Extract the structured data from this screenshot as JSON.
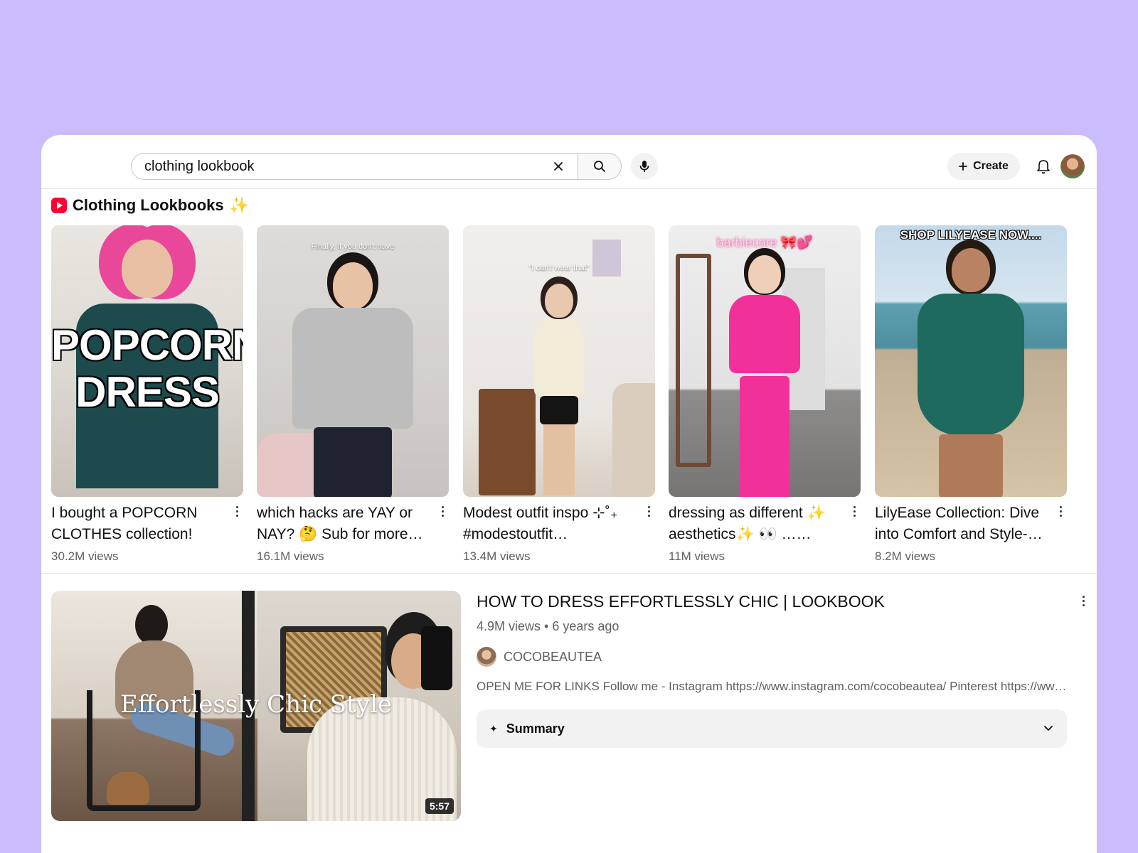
{
  "search": {
    "query": "clothing lookbook"
  },
  "header": {
    "create_label": "Create"
  },
  "shelf": {
    "title": "Clothing Lookbooks",
    "title_sparkle": "✨",
    "items": [
      {
        "title": "I bought a POPCORN CLOTHES collection!",
        "views": "30.2M views",
        "overlay": "POPCORN DRESS"
      },
      {
        "title": "which hacks are YAY or NAY? 🤔  Sub for more…",
        "views": "16.1M views",
        "overlay": "Finally, if you don't have"
      },
      {
        "title": "Modest outfit inspo ⊹˚₊ #modestoutfit…",
        "views": "13.4M views",
        "overlay": "\"I can't wear that\""
      },
      {
        "title": "dressing as different ✨ aesthetics✨ 👀 ……",
        "views": "11M views",
        "overlay": "barbiecore 🎀💕"
      },
      {
        "title": "LilyEase Collection: Dive into Comfort and Style-…",
        "views": "8.2M views",
        "overlay": "SHOP LILYEASE NOW...."
      }
    ]
  },
  "video": {
    "title": "HOW TO DRESS EFFORTLESSLY CHIC | LOOKBOOK",
    "stats": "4.9M views • 6 years ago",
    "channel": "COCOBEAUTEA",
    "description": "OPEN ME FOR LINKS Follow me - Instagram https://www.instagram.com/cocobeautea/ Pinterest https://www.pinterest.com/cocobeautea/",
    "overlay_text": "Effortlessly Chic Style",
    "duration": "5:57",
    "summary_label": "Summary"
  },
  "icons": {
    "clear": "close-icon",
    "search": "search-icon",
    "mic": "mic-icon",
    "create": "plus-icon",
    "notifications": "bell-icon",
    "summary": "sparkle-icon",
    "expand": "chevron-down-icon"
  },
  "colors": {
    "background": "#cbbdfd",
    "brand_red": "#ff0033",
    "secondary_text": "#606060",
    "pink_outfit": "#f1309a"
  }
}
